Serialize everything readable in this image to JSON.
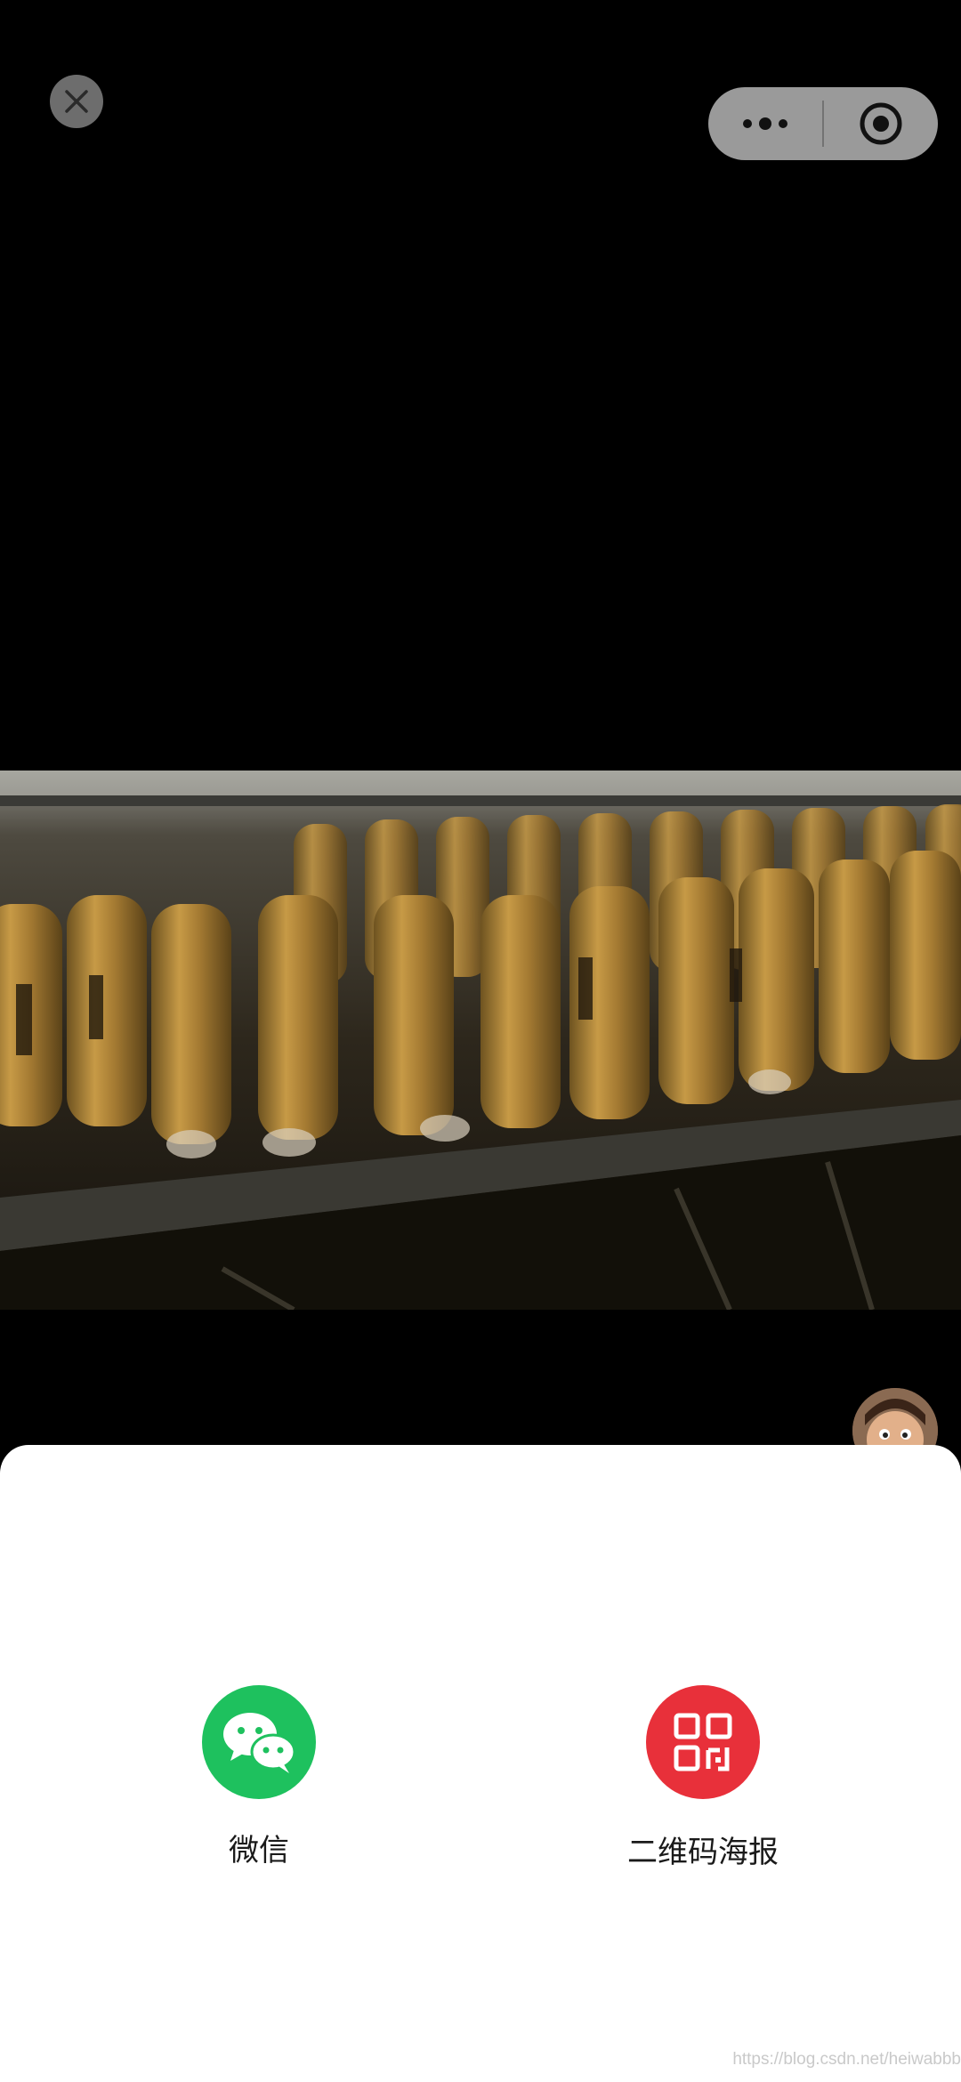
{
  "share_sheet": {
    "wechat_label": "微信",
    "poster_label": "二维码海报"
  },
  "colors": {
    "wechat_green": "#1aad19",
    "poster_red": "#e8303a",
    "capsule_gray": "#9a9a9a"
  },
  "icons": {
    "close": "close-icon",
    "more": "more-dots-icon",
    "target": "target-icon",
    "wechat": "wechat-icon",
    "qrcode": "qrcode-icon"
  },
  "watermark": "https://blog.csdn.net/heiwabbb"
}
